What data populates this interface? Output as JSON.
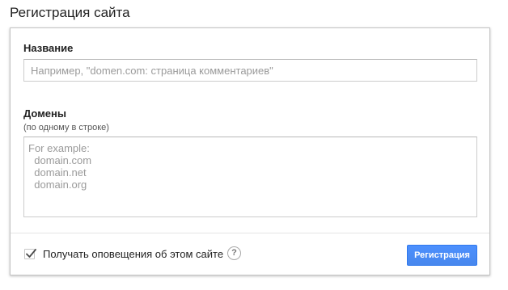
{
  "page": {
    "title": "Регистрация сайта"
  },
  "form": {
    "name_label": "Название",
    "name_placeholder": "Например, \"domen.com: страница комментариев\"",
    "name_value": "",
    "domains_label": "Домены",
    "domains_hint": "(по одному в строке)",
    "domains_placeholder": "For example:\n  domain.com\n  domain.net\n  domain.org",
    "domains_value": ""
  },
  "footer": {
    "notify_checked": true,
    "notify_label": "Получать оповещения об этом сайте",
    "help_symbol": "?",
    "submit_label": "Регистрация"
  },
  "colors": {
    "accent": "#4d90fe",
    "accent_border": "#3079ed"
  },
  "icons": {
    "checkbox": "checkmark-icon",
    "help": "question-circle-icon"
  }
}
